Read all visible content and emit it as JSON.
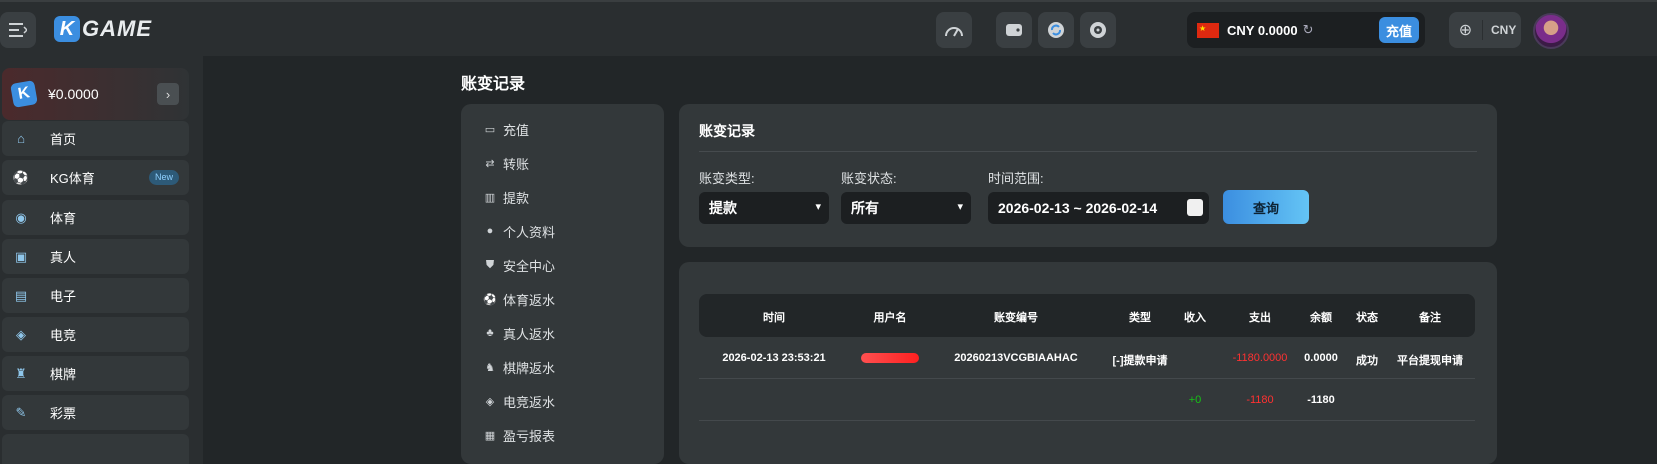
{
  "brand": {
    "logo_letter": "K",
    "name": "GAME"
  },
  "header": {
    "currency_code": "CNY",
    "balance": "CNY 0.0000",
    "recharge_label": "充值",
    "currency_selector": "CNY"
  },
  "sidebar": {
    "balance": "¥0.0000",
    "items": [
      {
        "label": "首页",
        "icon": "home-icon"
      },
      {
        "label": "KG体育",
        "icon": "soccer-ball-icon",
        "badge": "New"
      },
      {
        "label": "体育",
        "icon": "basketball-icon"
      },
      {
        "label": "真人",
        "icon": "cards-icon"
      },
      {
        "label": "电子",
        "icon": "slot-machine-icon"
      },
      {
        "label": "电竞",
        "icon": "gamepad-icon"
      },
      {
        "label": "棋牌",
        "icon": "chess-icon"
      },
      {
        "label": "彩票",
        "icon": "ticket-icon"
      }
    ]
  },
  "page": {
    "title": "账变记录"
  },
  "submenu": {
    "items": [
      {
        "label": "充值",
        "icon": "wallet-icon"
      },
      {
        "label": "转账",
        "icon": "transfer-icon"
      },
      {
        "label": "提款",
        "icon": "withdraw-icon"
      },
      {
        "label": "个人资料",
        "icon": "user-icon"
      },
      {
        "label": "安全中心",
        "icon": "shield-icon"
      },
      {
        "label": "体育返水",
        "icon": "soccer-ball-icon"
      },
      {
        "label": "真人返水",
        "icon": "people-icon"
      },
      {
        "label": "棋牌返水",
        "icon": "chess-icon"
      },
      {
        "label": "电竞返水",
        "icon": "gamepad-icon"
      },
      {
        "label": "盈亏报表",
        "icon": "report-icon"
      }
    ]
  },
  "filter": {
    "title": "账变记录",
    "type_label": "账变类型:",
    "type_value": "提款",
    "status_label": "账变状态:",
    "status_value": "所有",
    "range_label": "时间范围:",
    "range_value": "2026-02-13 ~ 2026-02-14",
    "query_label": "查询"
  },
  "table": {
    "headers": [
      "时间",
      "用户名",
      "账变编号",
      "类型",
      "收入",
      "支出",
      "余额",
      "状态",
      "备注"
    ],
    "row": {
      "time": "2026-02-13 23:53:21",
      "order_no": "20260213VCGBIAAHAC",
      "type": "[-]提款申请",
      "expense": "-1180.0000",
      "balance": "0.0000",
      "status": "成功",
      "remark": "平台提现申请"
    },
    "total": {
      "income": "+0",
      "expense": "-1180",
      "balance": "-1180"
    }
  },
  "colors": {
    "accent": "#3b8ee0",
    "negative": "#ff3131",
    "positive": "#16c216"
  }
}
